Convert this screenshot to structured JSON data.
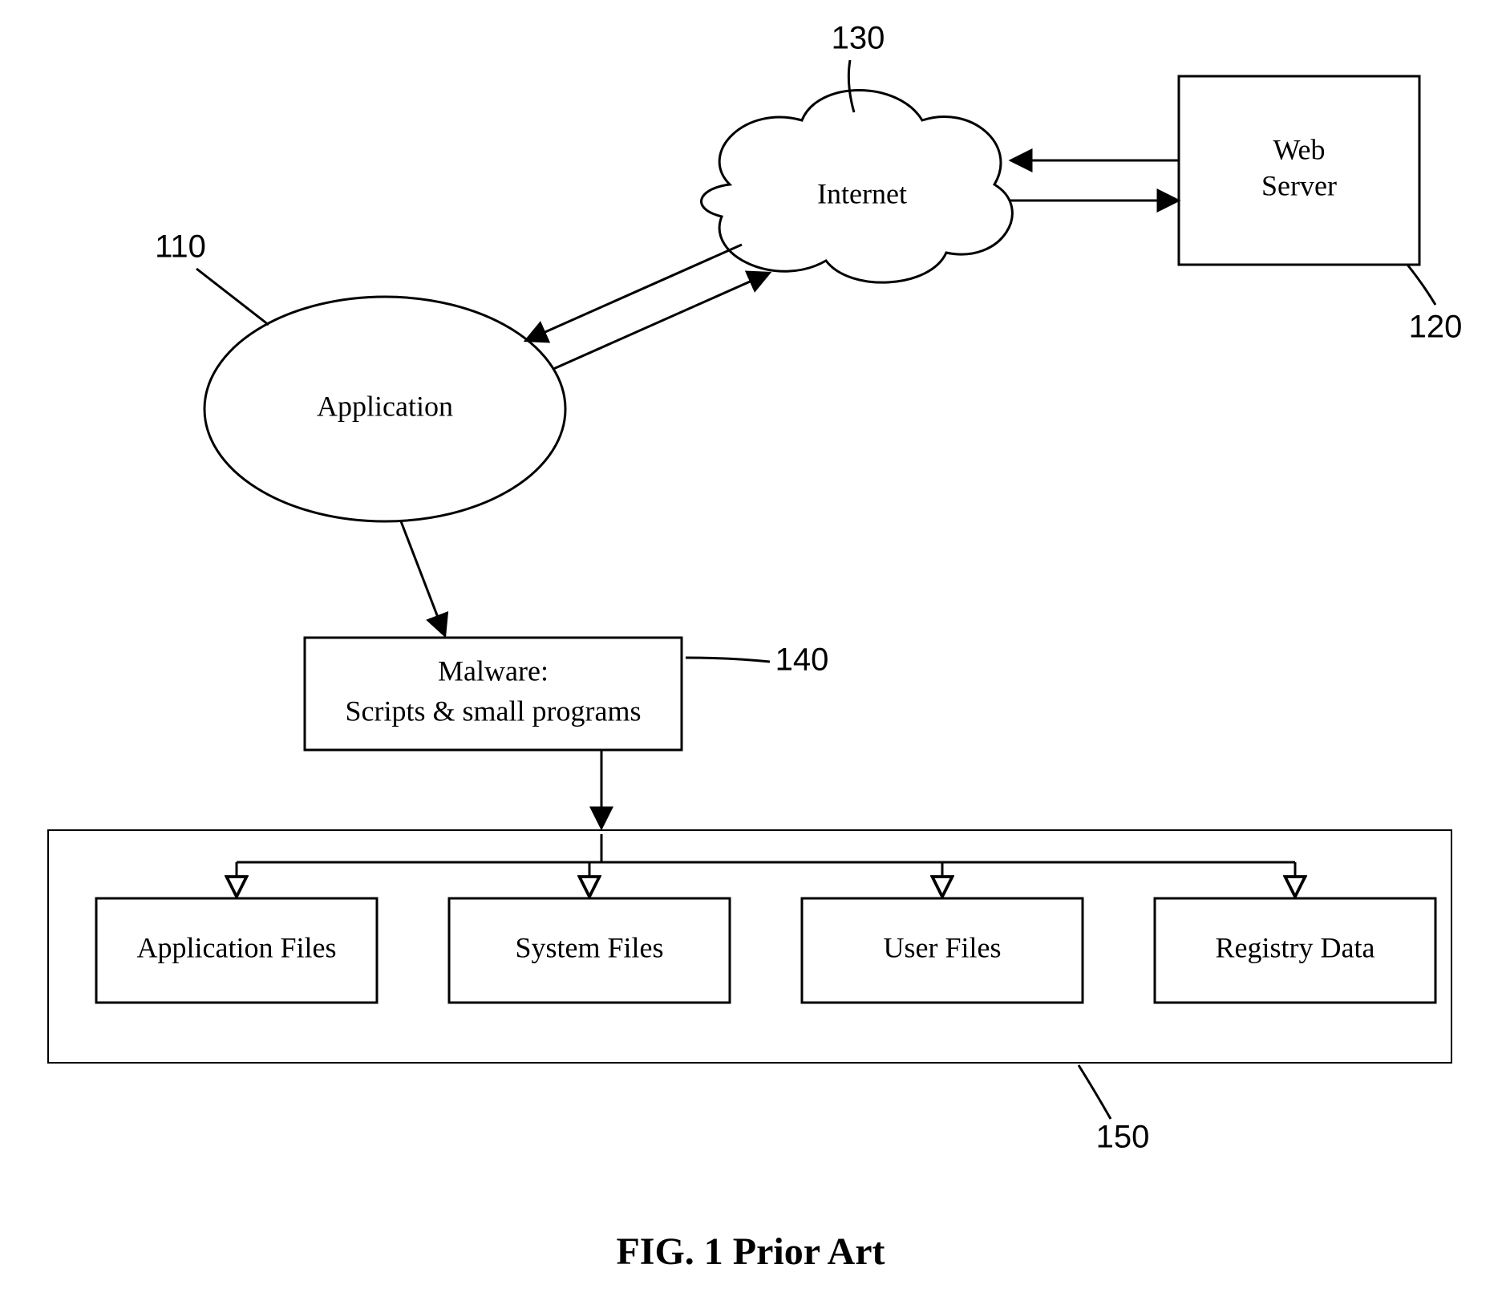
{
  "refs": {
    "application": "110",
    "webserver": "120",
    "internet": "130",
    "malware": "140",
    "resources": "150"
  },
  "nodes": {
    "application": "Application",
    "internet": "Internet",
    "webserver_line1": "Web",
    "webserver_line2": "Server",
    "malware_line1": "Malware:",
    "malware_line2": "Scripts & small programs",
    "res1": "Application Files",
    "res2": "System Files",
    "res3": "User Files",
    "res4": "Registry Data"
  },
  "caption": "FIG. 1 Prior Art"
}
